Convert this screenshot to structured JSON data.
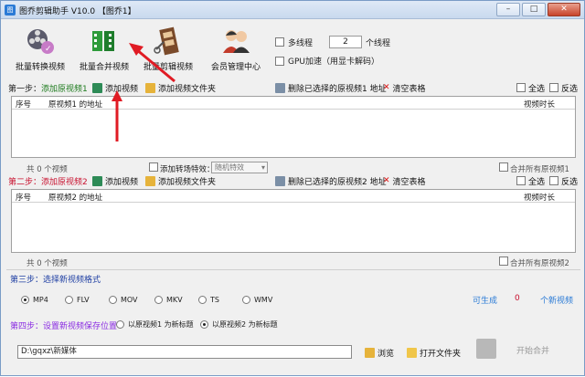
{
  "window": {
    "title": "图乔剪辑助手 V10.0 【图乔1】"
  },
  "toolbar": {
    "tools": [
      {
        "label": "批量转换视频"
      },
      {
        "label": "批量合并视频"
      },
      {
        "label": "批量剪辑视频"
      },
      {
        "label": "会员管理中心"
      }
    ],
    "multithread": {
      "label": "多线程",
      "value": "2",
      "suffix": "个线程"
    },
    "gpu": {
      "label": "GPU加速（用显卡解码）"
    }
  },
  "step1": {
    "prefix": "第一步：",
    "title": "添加原视频1",
    "add_video": "添加视频",
    "add_folder": "添加视频文件夹",
    "delete_selected": "删除已选择的原视频1 地址",
    "clear_table": "清空表格",
    "select_all": "全选",
    "invert": "反选",
    "columns": [
      "序号",
      "原视频1 的地址",
      "视频时长"
    ],
    "count_text": "共 0 个视频",
    "transition_label": "添加转场特效：",
    "transition_value": "随机特效",
    "merge_all": "合并所有原视频1"
  },
  "step2": {
    "prefix": "第二步：",
    "title": "添加原视频2",
    "add_video": "添加视频",
    "add_folder": "添加视频文件夹",
    "delete_selected": "删除已选择的原视频2 地址",
    "clear_table": "清空表格",
    "select_all": "全选",
    "invert": "反选",
    "columns": [
      "序号",
      "原视频2 的地址",
      "视频时长"
    ],
    "count_text": "共 0 个视频",
    "merge_all": "合并所有原视频2"
  },
  "step3": {
    "title": "第三步：选择新视频格式",
    "formats": [
      "MP4",
      "FLV",
      "MOV",
      "MKV",
      "TS",
      "WMV"
    ],
    "selected_format": "MP4",
    "can_generate_label": "可生成",
    "can_generate_count": "0",
    "can_generate_suffix": "个新视频"
  },
  "step4": {
    "title": "第四步：设置新视频保存位置",
    "option1": "以原视频1 为新标题",
    "option2": "以原视频2 为新标题",
    "path": "D:\\gqxz\\新媒体",
    "browse": "浏览",
    "open_folder": "打开文件夹",
    "start": "开始合并"
  },
  "colors": {
    "accent_red": "#c8102e",
    "accent_green": "#1c7a1c",
    "arrow": "#e01b24"
  }
}
